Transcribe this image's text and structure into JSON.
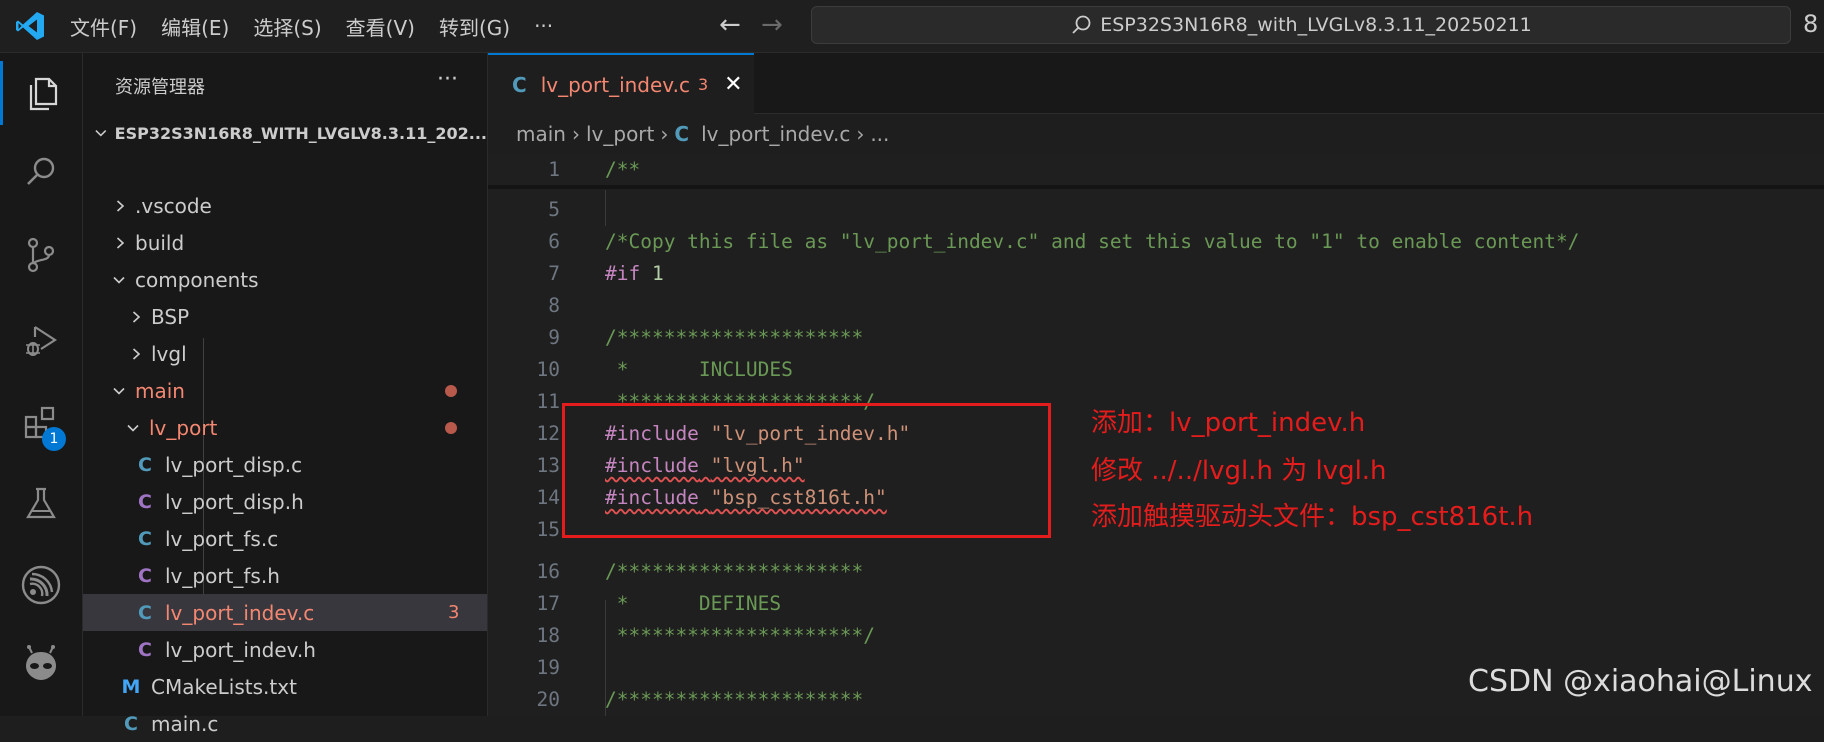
{
  "menu": {
    "items": [
      "文件(F)",
      "编辑(E)",
      "选择(S)",
      "查看(V)",
      "转到(G)"
    ],
    "more": "···"
  },
  "nav": {
    "back": "←",
    "forward": "→"
  },
  "search": {
    "text": "ESP32S3N16R8_with_LVGLv8.3.11_20250211"
  },
  "titlebar_right": "8",
  "activity": {
    "extensions_badge": "1"
  },
  "explorer": {
    "title": "资源管理器",
    "more": "···",
    "root": "ESP32S3N16R8_WITH_LVGLV8.3.11_202...",
    "items": [
      {
        "label": ".vscode"
      },
      {
        "label": "build"
      },
      {
        "label": "components"
      },
      {
        "label": "BSP"
      },
      {
        "label": "lvgl"
      },
      {
        "label": "main"
      },
      {
        "label": "lv_port"
      },
      {
        "label": "lv_port_disp.c",
        "icon": "C"
      },
      {
        "label": "lv_port_disp.h",
        "icon": "C"
      },
      {
        "label": "lv_port_fs.c",
        "icon": "C"
      },
      {
        "label": "lv_port_fs.h",
        "icon": "C"
      },
      {
        "label": "lv_port_indev.c",
        "icon": "C",
        "count": "3"
      },
      {
        "label": "lv_port_indev.h",
        "icon": "C"
      },
      {
        "label": "CMakeLists.txt",
        "icon": "M"
      },
      {
        "label": "main.c",
        "icon": "C"
      }
    ]
  },
  "tab": {
    "icon": "C",
    "name": "lv_port_indev.c",
    "count": "3",
    "close": "✕"
  },
  "breadcrumb": {
    "parts": [
      "main",
      "lv_port",
      "lv_port_indev.c",
      "..."
    ],
    "file_icon": "C"
  },
  "code": {
    "lines": [
      {
        "n": "1",
        "parts": [
          {
            "t": "/**",
            "c": "cm"
          }
        ]
      },
      {
        "n": "5",
        "parts": []
      },
      {
        "n": "6",
        "parts": [
          {
            "t": "/*Copy this file as \"lv_port_indev.c\" and set this value to \"1\" to enable content*/",
            "c": "cm"
          }
        ]
      },
      {
        "n": "7",
        "parts": [
          {
            "t": "#if",
            "c": "pp"
          },
          {
            "t": " 1",
            "c": "num"
          }
        ]
      },
      {
        "n": "8",
        "parts": []
      },
      {
        "n": "9",
        "parts": [
          {
            "t": "/*********************",
            "c": "cm"
          }
        ]
      },
      {
        "n": "10",
        "parts": [
          {
            "t": " *      INCLUDES",
            "c": "cm"
          }
        ]
      },
      {
        "n": "11",
        "parts": [
          {
            "t": " *********************/",
            "c": "cm"
          }
        ]
      },
      {
        "n": "12",
        "parts": [
          {
            "t": "#include",
            "c": "pp"
          },
          {
            "t": " ",
            "c": ""
          },
          {
            "t": "\"lv_port_indev.h\"",
            "c": "str"
          }
        ]
      },
      {
        "n": "13",
        "parts": [
          {
            "t": "#include",
            "c": "pp squig"
          },
          {
            "t": " ",
            "c": "squig"
          },
          {
            "t": "\"lvgl.h\"",
            "c": "str squig"
          }
        ]
      },
      {
        "n": "14",
        "parts": [
          {
            "t": "#include",
            "c": "pp squig"
          },
          {
            "t": " ",
            "c": "squig"
          },
          {
            "t": "\"bsp_cst816t.h\"",
            "c": "str squig"
          }
        ]
      },
      {
        "n": "15",
        "parts": []
      },
      {
        "n": "16",
        "parts": [
          {
            "t": "/*********************",
            "c": "cm"
          }
        ]
      },
      {
        "n": "17",
        "parts": [
          {
            "t": " *      DEFINES",
            "c": "cm"
          }
        ]
      },
      {
        "n": "18",
        "parts": [
          {
            "t": " *********************/",
            "c": "cm"
          }
        ]
      },
      {
        "n": "19",
        "parts": []
      },
      {
        "n": "20",
        "parts": [
          {
            "t": "/*********************",
            "c": "cm"
          }
        ]
      }
    ]
  },
  "annotations": [
    "添加：lv_port_indev.h",
    "修改  ../../lvgl.h 为 lvgl.h",
    "添加触摸驱动头文件：bsp_cst816t.h"
  ],
  "watermark": "CSDN @xiaohai@Linux",
  "colors": {
    "accent": "#0078d4",
    "annotation_red": "#e41c1c",
    "modified": "#f48771"
  }
}
